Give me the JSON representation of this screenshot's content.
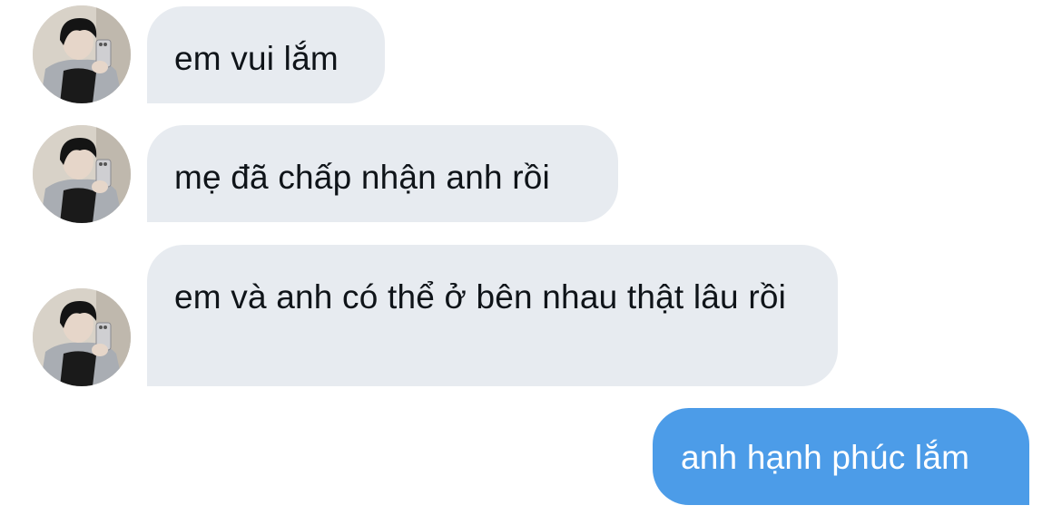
{
  "conversation": {
    "messages": [
      {
        "direction": "incoming",
        "text": "em vui lắm",
        "avatar": "profile-avatar"
      },
      {
        "direction": "incoming",
        "text": "mẹ đã chấp nhận anh rồi",
        "avatar": "profile-avatar"
      },
      {
        "direction": "incoming",
        "text": "em và anh có thể ở bên nhau thật lâu rồi",
        "avatar": "profile-avatar"
      },
      {
        "direction": "outgoing",
        "text": "anh hạnh phúc lắm"
      }
    ]
  },
  "colors": {
    "incoming_bubble": "#e7ebf0",
    "incoming_text": "#0f1419",
    "outgoing_bubble": "#4c9ce8",
    "outgoing_text": "#ffffff",
    "background": "#ffffff"
  }
}
